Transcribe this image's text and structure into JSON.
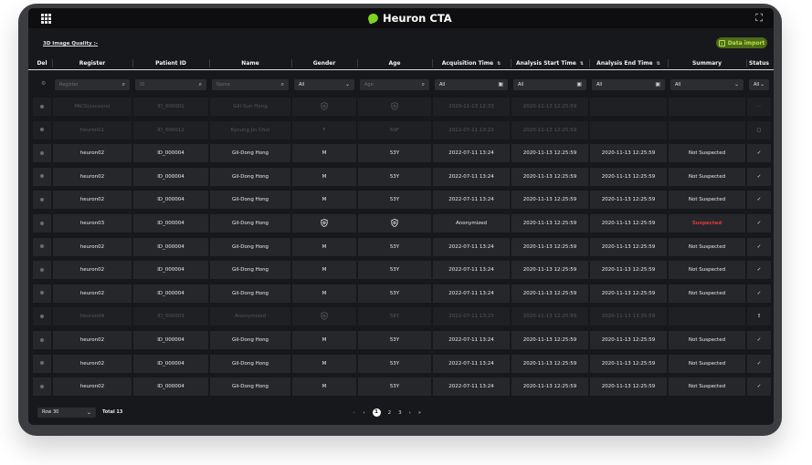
{
  "titlebar": {
    "app_title": "Heuron CTA"
  },
  "toolbar": {
    "quality_link": "3D Image Quality :-",
    "import_label": "Data import"
  },
  "table": {
    "headers": [
      "Del",
      "Register",
      "Patient ID",
      "Name",
      "Gender",
      "Age",
      "Acquisition Time",
      "Analysis Start Time",
      "Analysis End Time",
      "Summary",
      "Status"
    ],
    "sort_symbol": "⇅",
    "filters": {
      "register_placeholder": "Register",
      "id_placeholder": "ID",
      "name_placeholder": "Name",
      "gender_value": "All",
      "age_placeholder": "Age",
      "acq_value": "All",
      "start_value": "All",
      "end_value": "All",
      "summary_value": "All",
      "status_value": "All"
    },
    "rows": [
      {
        "dim": true,
        "register": "PACS(xxcxxrs)",
        "pid": "ID_000001",
        "name": "Gill-Sun Hong",
        "gender": "shield",
        "age": "shield",
        "acq": "2020-11-13 12:33",
        "start": "2020-11-13 12:25:59",
        "end": "",
        "summary": "",
        "status": "···"
      },
      {
        "dim": true,
        "register": "heuron01",
        "pid": "ID_000012",
        "name": "Kyoung Jin Choi",
        "gender": "F",
        "age": "69F",
        "acq": "2022-07-11 13:22",
        "start": "2020-11-13 12:25:59",
        "end": "",
        "summary": "",
        "status": "spinner"
      },
      {
        "dim": false,
        "register": "heuron02",
        "pid": "ID_000004",
        "name": "Gil-Dong Hong",
        "gender": "M",
        "age": "53Y",
        "acq": "2022-07-11 13:24",
        "start": "2020-11-13 12:25:59",
        "end": "2020-11-13 12:25:59",
        "summary": "Not Suspected",
        "status": "check"
      },
      {
        "dim": false,
        "register": "heuron02",
        "pid": "ID_000004",
        "name": "Gil-Dong Hong",
        "gender": "M",
        "age": "53Y",
        "acq": "2022-07-11 13:24",
        "start": "2020-11-13 12:25:59",
        "end": "2020-11-13 12:25:59",
        "summary": "Not Suspected",
        "status": "check"
      },
      {
        "dim": false,
        "register": "heuron02",
        "pid": "ID_000004",
        "name": "Gil-Dong Hong",
        "gender": "M",
        "age": "53Y",
        "acq": "2022-07-11 13:24",
        "start": "2020-11-13 12:25:59",
        "end": "2020-11-13 12:25:59",
        "summary": "Not Suspected",
        "status": "check"
      },
      {
        "dim": false,
        "register": "heuron03",
        "pid": "ID_000004",
        "name": "Gil-Dong Hong",
        "gender": "shield",
        "age": "shield",
        "acq": "Anonymized",
        "start": "2020-11-13 12:25:59",
        "end": "2020-11-13 12:25:59",
        "summary": "Suspected",
        "status": "check"
      },
      {
        "dim": false,
        "register": "heuron02",
        "pid": "ID_000004",
        "name": "Gil-Dong Hong",
        "gender": "M",
        "age": "53Y",
        "acq": "2022-07-11 13:24",
        "start": "2020-11-13 12:25:59",
        "end": "2020-11-13 12:25:59",
        "summary": "Not Suspected",
        "status": "check"
      },
      {
        "dim": false,
        "register": "heuron02",
        "pid": "ID_000004",
        "name": "Gil-Dong Hong",
        "gender": "M",
        "age": "53Y",
        "acq": "2022-07-11 13:24",
        "start": "2020-11-13 12:25:59",
        "end": "2020-11-13 12:25:59",
        "summary": "Not Suspected",
        "status": "check"
      },
      {
        "dim": false,
        "register": "heuron02",
        "pid": "ID_000004",
        "name": "Gil-Dong Hong",
        "gender": "M",
        "age": "53Y",
        "acq": "2022-07-11 13:24",
        "start": "2020-11-13 12:25:59",
        "end": "2020-11-13 12:25:59",
        "summary": "Not Suspected",
        "status": "check"
      },
      {
        "dim": true,
        "register": "heuron04",
        "pid": "ID_000003",
        "name": "Anonymized",
        "gender": "shield",
        "age": "58Y",
        "acq": "2022-07-11 13:23",
        "start": "2020-11-13 12:25:59",
        "end": "2020-11-13 13:35:59",
        "summary": "",
        "status": "!"
      },
      {
        "dim": false,
        "register": "heuron02",
        "pid": "ID_000004",
        "name": "Gil-Dong Hong",
        "gender": "M",
        "age": "53Y",
        "acq": "2022-07-11 13:24",
        "start": "2020-11-13 12:25:59",
        "end": "2020-11-13 12:25:59",
        "summary": "Not Suspected",
        "status": "check"
      },
      {
        "dim": false,
        "register": "heuron02",
        "pid": "ID_000004",
        "name": "Gil-Dong Hong",
        "gender": "M",
        "age": "53Y",
        "acq": "2022-07-11 13:24",
        "start": "2020-11-13 12:25:59",
        "end": "2020-11-13 12:25:59",
        "summary": "Not Suspected",
        "status": "check"
      },
      {
        "dim": false,
        "register": "heuron02",
        "pid": "ID_000004",
        "name": "Gil-Dong Hong",
        "gender": "M",
        "age": "53Y",
        "acq": "2022-07-11 13:24",
        "start": "2020-11-13 12:25:59",
        "end": "2020-11-13 12:25:59",
        "summary": "Not Suspected",
        "status": "check"
      }
    ]
  },
  "footer": {
    "rows_value": "Row 30",
    "total": "Total 13",
    "pages": [
      "1",
      "2",
      "3"
    ],
    "current_page": "1"
  },
  "colors": {
    "accent": "#7ed321",
    "suspected": "#e53935",
    "row_bg": "#26272b",
    "screen_bg": "#17181b"
  }
}
